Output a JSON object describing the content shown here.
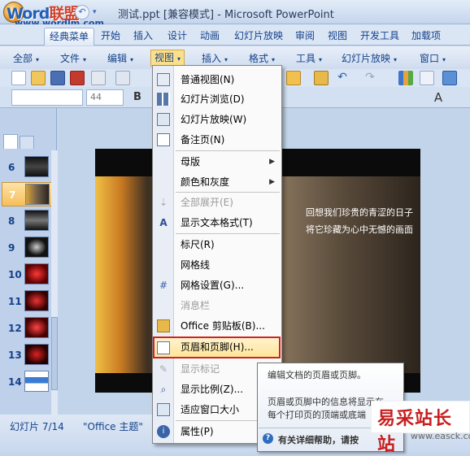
{
  "window": {
    "title": "测试.ppt [兼容模式] - Microsoft PowerPoint",
    "watermark_logo_a": "Word",
    "watermark_logo_b": "联盟",
    "watermark_url": "www.wordlm.com"
  },
  "ribbon_tabs": [
    "经典菜单",
    "开始",
    "插入",
    "设计",
    "动画",
    "幻灯片放映",
    "审阅",
    "视图",
    "开发工具",
    "加载项"
  ],
  "menubar": [
    "全部",
    "文件",
    "编辑",
    "视图",
    "插入",
    "格式",
    "工具",
    "幻灯片放映",
    "窗口"
  ],
  "toolbar": {
    "font_size": "44",
    "bold": "B"
  },
  "slides": {
    "numbers": [
      "6",
      "7",
      "8",
      "9",
      "10",
      "11",
      "12",
      "13",
      "14"
    ],
    "selected": "7"
  },
  "slide_text": {
    "line1": "回想我们珍贵的青涩的日子",
    "line2": "将它珍藏为心中无憾的画面"
  },
  "view_menu": {
    "items": [
      {
        "label": "普通视图(N)",
        "icon": "normal-view-icon",
        "disabled": false
      },
      {
        "label": "幻灯片浏览(D)",
        "icon": "slide-sorter-icon",
        "disabled": false
      },
      {
        "label": "幻灯片放映(W)",
        "icon": "slideshow-icon",
        "disabled": false
      },
      {
        "label": "备注页(N)",
        "icon": "notes-page-icon",
        "disabled": false
      },
      {
        "label": "母版",
        "icon": "",
        "disabled": false,
        "submenu": true
      },
      {
        "label": "颜色和灰度",
        "icon": "",
        "disabled": false,
        "submenu": true
      },
      {
        "label": "全部展开(E)",
        "icon": "expand-all-icon",
        "disabled": true
      },
      {
        "label": "显示文本格式(T)",
        "icon": "text-format-icon",
        "disabled": false
      },
      {
        "label": "标尺(R)",
        "icon": "",
        "disabled": false
      },
      {
        "label": "网格线",
        "icon": "",
        "disabled": false
      },
      {
        "label": "网格设置(G)...",
        "icon": "grid-icon",
        "disabled": false
      },
      {
        "label": "消息栏",
        "icon": "",
        "disabled": true
      },
      {
        "label": "Office 剪贴板(B)...",
        "icon": "clipboard-icon",
        "disabled": false
      },
      {
        "label": "页眉和页脚(H)...",
        "icon": "header-footer-icon",
        "disabled": false,
        "highlighted": true
      },
      {
        "label": "显示标记",
        "icon": "markup-icon",
        "disabled": true
      },
      {
        "label": "显示比例(Z)...",
        "icon": "zoom-icon",
        "disabled": false
      },
      {
        "label": "适应窗口大小",
        "icon": "fit-window-icon",
        "disabled": false
      },
      {
        "label": "属性(P)",
        "icon": "properties-icon",
        "disabled": false
      }
    ]
  },
  "tooltip": {
    "line1": "编辑文档的页眉或页脚。",
    "line2": "页眉或页脚中的信息将显示在",
    "line3": "每个打印页的顶端或底端",
    "help": "有关详细帮助，请按"
  },
  "statusbar": {
    "slide_info": "幻灯片 7/14",
    "theme": "\"Office 主题\""
  },
  "site_watermark": {
    "cn": "易采站长站",
    "url": "www.easck.com"
  }
}
